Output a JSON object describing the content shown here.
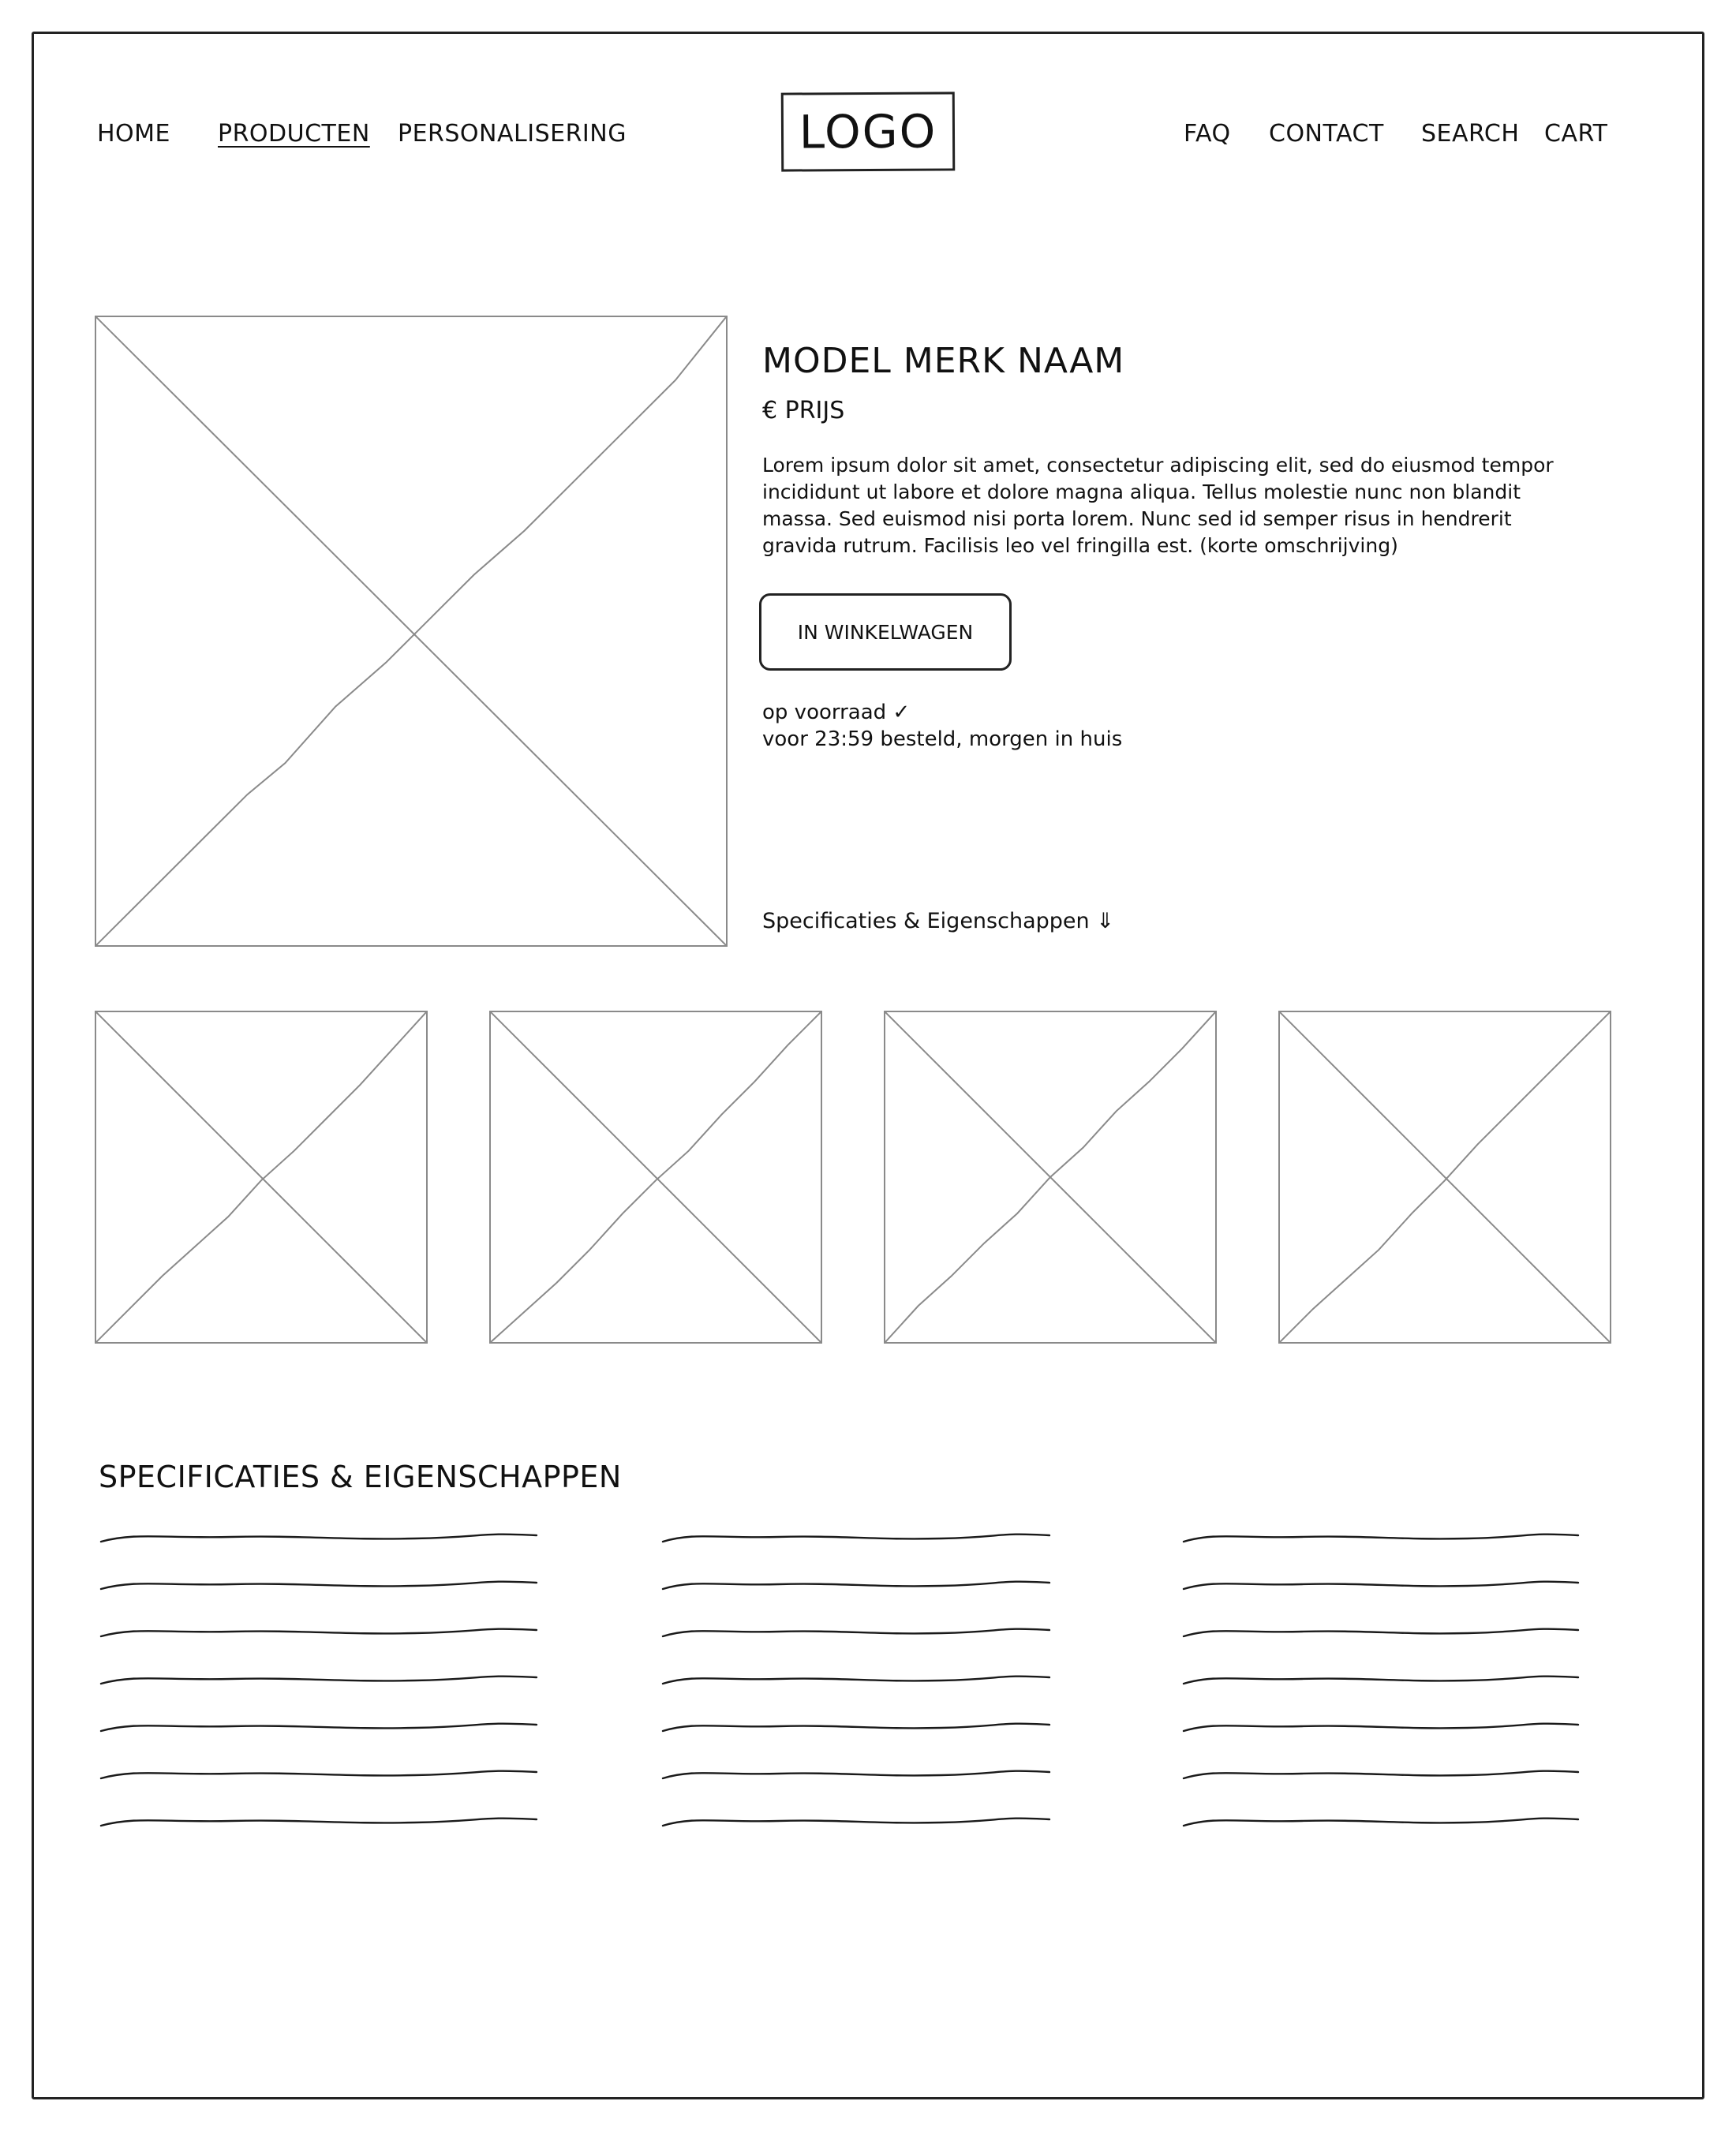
{
  "nav": {
    "left": [
      "HOME",
      "PRODUCTEN",
      "PERSONALISERING"
    ],
    "active": "PRODUCTEN",
    "logo": "LOGO",
    "right": [
      "FAQ",
      "CONTACT",
      "SEARCH",
      "CART"
    ]
  },
  "product": {
    "title": "MODEL MERK NAAM",
    "price": "€ PRIJS",
    "description": "Lorem ipsum dolor sit amet, consectetur adipiscing elit, sed do eiusmod tempor incididunt ut labore et dolore magna aliqua. Tellus molestie nunc non blandit massa. Sed euismod nisi porta lorem. Nunc sed id semper risus in hendrerit gravida rutrum. Facilisis leo vel fringilla est.  (korte omschrijving)",
    "add_to_cart": "IN WINKELWAGEN",
    "stock_status": "op voorraad ✓",
    "delivery": "voor 23:59 besteld, morgen in huis",
    "specs_link": "Specificaties & Eigenschappen ⇓"
  },
  "specs": {
    "heading": "SPECIFICATIES & EIGENSCHAPPEN"
  },
  "icons": {
    "image_placeholder": "image-placeholder-icon",
    "check": "check-icon",
    "arrow_down": "double-arrow-down-icon"
  },
  "colors": {
    "ink": "#111111",
    "placeholder_stroke": "#8a8a8a",
    "background": "#ffffff"
  }
}
